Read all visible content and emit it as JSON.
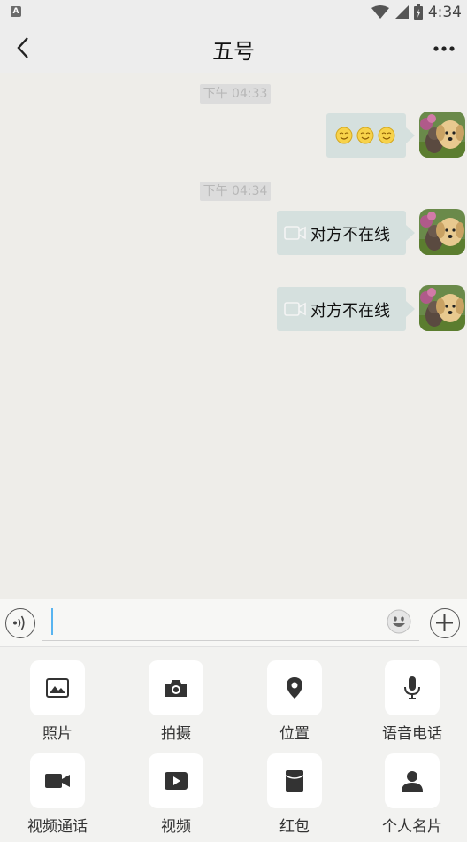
{
  "status_bar": {
    "time": "4:34",
    "left_icon": "A",
    "icons": [
      "wifi-icon",
      "signal-icon",
      "battery-charging-icon"
    ]
  },
  "header": {
    "title": "五号",
    "back_icon": "chevron-left-icon",
    "more_icon": "more-dots-icon"
  },
  "messages": {
    "timestamp_1": "下午 04:33",
    "timestamp_2": "下午 04:34",
    "message_1_emojis": [
      "smile-emoji",
      "smile-emoji",
      "smile-emoji"
    ],
    "message_2_text": "对方不在线",
    "message_3_text": "对方不在线",
    "bubble_color": "#d5e0de"
  },
  "input_bar": {
    "voice_icon": "voice-wave-icon",
    "text_value": "",
    "emoji_icon": "smiley-icon",
    "plus_icon": "plus-circle-icon"
  },
  "tools": [
    {
      "label": "照片",
      "icon": "image-icon"
    },
    {
      "label": "拍摄",
      "icon": "camera-icon"
    },
    {
      "label": "位置",
      "icon": "location-pin-icon"
    },
    {
      "label": "语音电话",
      "icon": "microphone-icon"
    },
    {
      "label": "视频通话",
      "icon": "video-camera-icon"
    },
    {
      "label": "视频",
      "icon": "video-play-icon"
    },
    {
      "label": "红包",
      "icon": "red-envelope-icon"
    },
    {
      "label": "个人名片",
      "icon": "person-card-icon"
    }
  ]
}
